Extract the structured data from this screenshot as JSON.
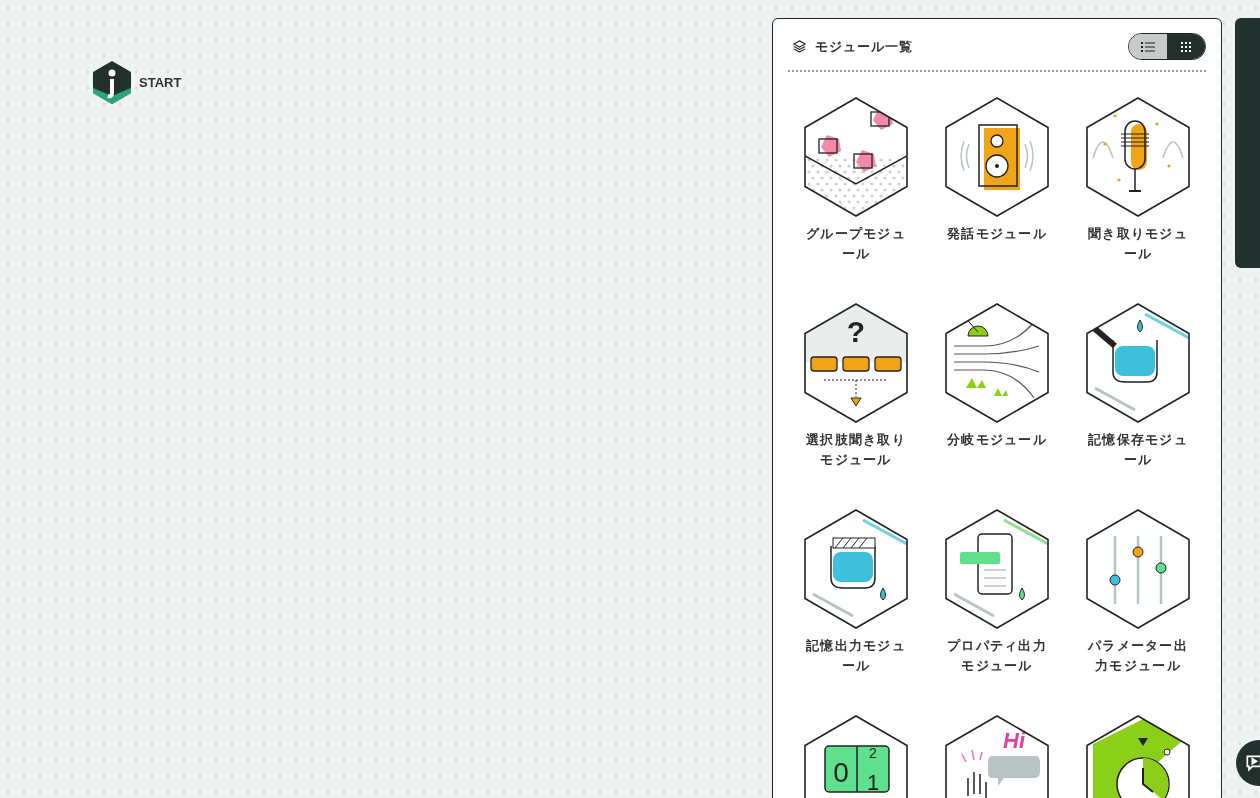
{
  "start": {
    "label": "START"
  },
  "panel": {
    "title": "モジュール一覧",
    "view_toggle": [
      {
        "kind": "list",
        "selected": false
      },
      {
        "kind": "grid",
        "selected": true
      }
    ]
  },
  "modules": [
    {
      "kind": "group",
      "label": "グループモジュール"
    },
    {
      "kind": "speaker",
      "label": "発話モジュール"
    },
    {
      "kind": "mic",
      "label": "聞き取りモジュール"
    },
    {
      "kind": "choice",
      "label": "選択肢聞き取りモジュール",
      "art_text": [
        "?"
      ]
    },
    {
      "kind": "branch",
      "label": "分岐モジュール"
    },
    {
      "kind": "store",
      "label": "記憶保存モジュール"
    },
    {
      "kind": "recall",
      "label": "記憶出力モジュール"
    },
    {
      "kind": "property",
      "label": "プロパティ出力モジュール"
    },
    {
      "kind": "param",
      "label": "パラメーター出力モジュール"
    },
    {
      "kind": "counter",
      "art_text": [
        "0",
        "2",
        "1"
      ]
    },
    {
      "kind": "greet",
      "art_text": [
        "Hi"
      ]
    },
    {
      "kind": "timer"
    }
  ]
}
